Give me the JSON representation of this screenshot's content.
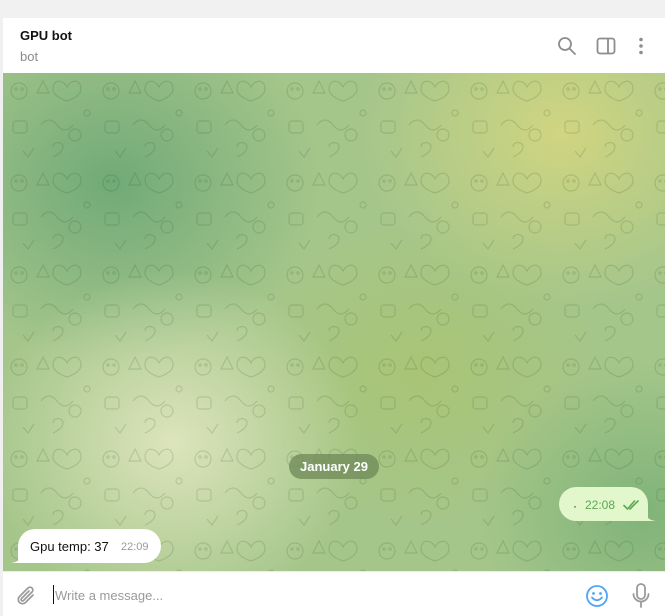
{
  "chat": {
    "title": "GPU bot",
    "subtitle": "bot"
  },
  "header_icons": [
    "search-icon",
    "sidebar-toggle-icon",
    "more-vertical-icon"
  ],
  "date_separator": "January 29",
  "messages": [
    {
      "direction": "outgoing",
      "text": "·",
      "time": "22:08",
      "status": "read-double-check"
    },
    {
      "direction": "incoming",
      "text": "Gpu temp: 37",
      "time": "22:09"
    }
  ],
  "composer": {
    "placeholder": "Write a message..."
  },
  "colors": {
    "accent": "#4ea4f6",
    "outgoing_bubble": "#e2f7cb",
    "outgoing_meta": "#5ca853",
    "date_pill": "#718b58"
  }
}
